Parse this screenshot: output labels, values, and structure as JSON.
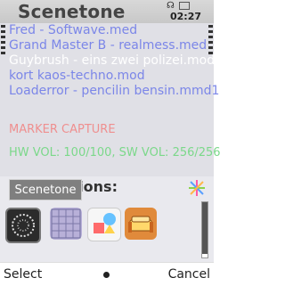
{
  "title": "Scenetone",
  "status": {
    "clock": "02:27"
  },
  "scene": {
    "mods": [
      {
        "text": "Fred - Softwave.med",
        "color": "#7b86e8"
      },
      {
        "text": "Grand Master B - realmess.med",
        "color": "#7b86e8"
      },
      {
        "text": "Guybrush - eins zwei polizei.mod",
        "color": "#ffffff"
      },
      {
        "text": "kort kaos-techno.mod",
        "color": "#7b86e8"
      },
      {
        "text": "Loaderror - pencilin bensin.mmd1",
        "color": "#7b86e8"
      }
    ],
    "marker": "MARKER CAPTURE",
    "volume": "HW VOL: 100/100, SW VOL: 256/256"
  },
  "apps": {
    "title": "Applications:",
    "tooltip": "Scenetone",
    "icons": [
      "scenetone-app-icon",
      "calendar-grid-icon",
      "shapes-app-icon",
      "sofa-app-icon"
    ]
  },
  "softkeys": {
    "left": "Select",
    "right": "Cancel"
  }
}
